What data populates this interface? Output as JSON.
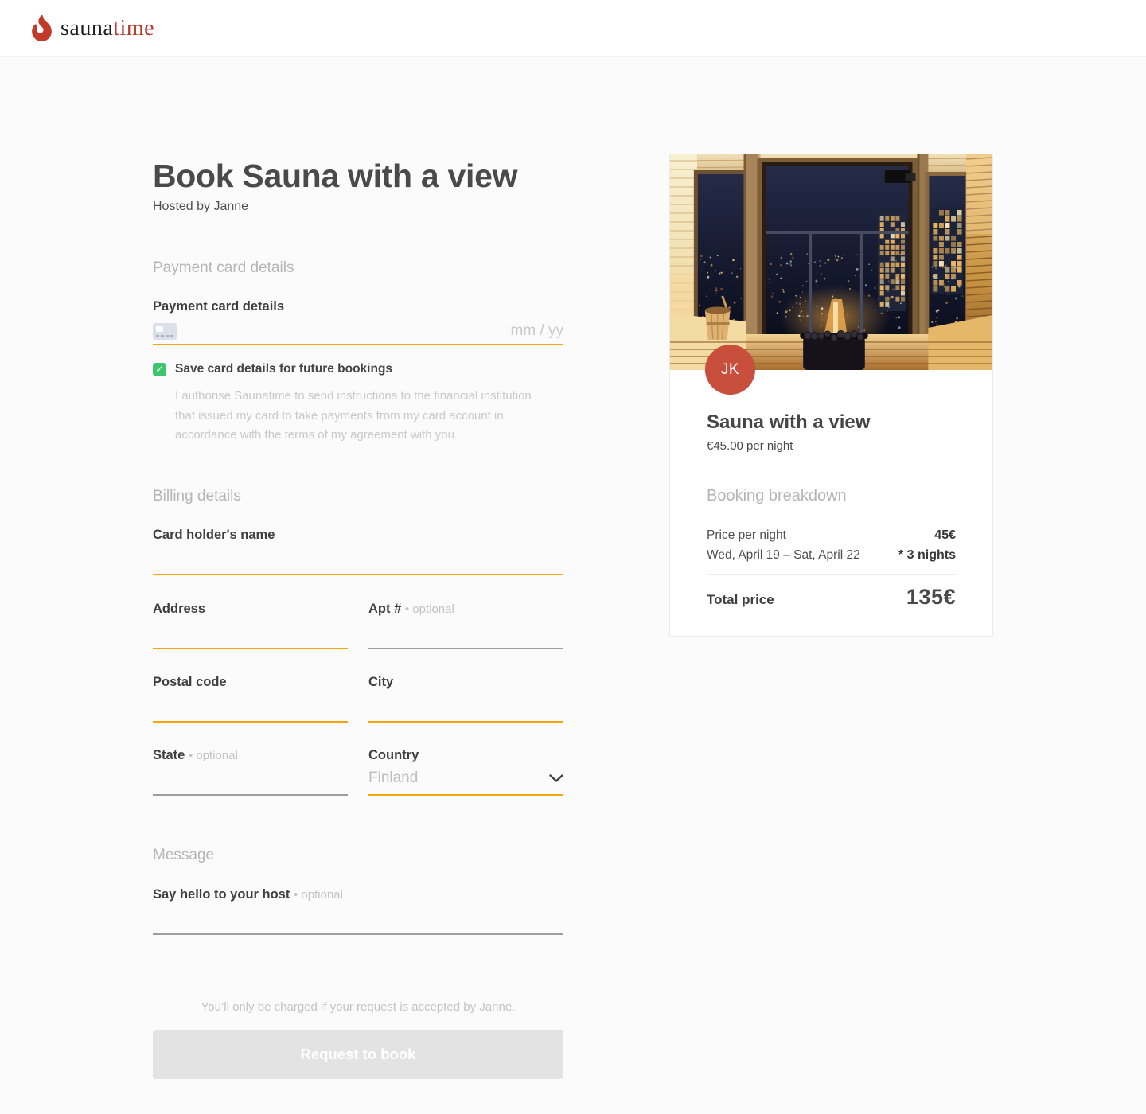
{
  "header": {
    "logo_word_primary": "sauna",
    "logo_word_secondary": "time"
  },
  "icons": {
    "check": "✓",
    "flame": "flame-icon",
    "chevron_down": "chevron-down-icon",
    "credit_card": "credit-card-icon"
  },
  "colors": {
    "accent_orange": "#F6A50B",
    "checkbox_green": "#3EC46F",
    "avatar_red": "#C94F3D",
    "logo_red": "#B53A2B",
    "muted_underline": "#9E9E9E",
    "disabled_button": "#E3E3E3"
  },
  "page": {
    "title": "Book Sauna with a view",
    "subtitle": "Hosted by Janne"
  },
  "payment": {
    "section_header": "Payment card details",
    "card_label": "Payment card details",
    "card_value": "",
    "expiry_placeholder": "mm / yy",
    "save_label": "Save card details for future bookings",
    "save_checked": true,
    "authorization_text": "I authorise Saunatime to send instructions to the financial institution that issued my card to take payments from my card account in accordance with the terms of my agreement with you."
  },
  "billing": {
    "section_header": "Billing details",
    "card_holder_label": "Card holder's name",
    "address_label": "Address",
    "apt_label": "Apt #",
    "apt_optional": "• optional",
    "postal_label": "Postal code",
    "city_label": "City",
    "state_label": "State",
    "state_optional": "• optional",
    "country_label": "Country",
    "country_value": "Finland"
  },
  "message": {
    "section_header": "Message",
    "label": "Say hello to your host",
    "optional": "• optional"
  },
  "footer": {
    "note": "You’ll only be charged if your request is accepted by Janne.",
    "button_label": "Request to book"
  },
  "listing_card": {
    "host_initials": "JK",
    "title": "Sauna with a view",
    "price_caption": "€45.00 per night",
    "breakdown_header": "Booking breakdown",
    "rows": [
      {
        "label": "Price per night",
        "value": "45€"
      },
      {
        "label": "Wed, April 19 – Sat, April 22",
        "value": "* 3 nights"
      }
    ],
    "total_label": "Total price",
    "total_value": "135€"
  }
}
